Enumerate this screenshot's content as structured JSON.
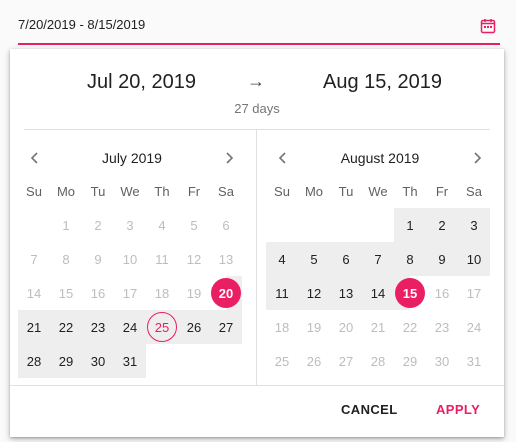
{
  "input": {
    "value": "7/20/2019 - 8/15/2019",
    "icon": "calendar-icon",
    "accent": "#e91e63"
  },
  "range": {
    "start": "Jul 20, 2019",
    "arrow": "→",
    "end": "Aug 15, 2019",
    "days": "27 days"
  },
  "weekdays": [
    "Su",
    "Mo",
    "Tu",
    "We",
    "Th",
    "Fr",
    "Sa"
  ],
  "left": {
    "title": "July 2019",
    "rows": [
      [
        "",
        "1",
        "2",
        "3",
        "4",
        "5",
        "6"
      ],
      [
        "7",
        "8",
        "9",
        "10",
        "11",
        "12",
        "13"
      ],
      [
        "14",
        "15",
        "16",
        "17",
        "18",
        "19",
        "20"
      ],
      [
        "21",
        "22",
        "23",
        "24",
        "25",
        "26",
        "27"
      ],
      [
        "28",
        "29",
        "30",
        "31",
        "",
        "",
        ""
      ]
    ]
  },
  "right": {
    "title": "August 2019",
    "rows": [
      [
        "",
        "",
        "",
        "",
        "1",
        "2",
        "3"
      ],
      [
        "4",
        "5",
        "6",
        "7",
        "8",
        "9",
        "10"
      ],
      [
        "11",
        "12",
        "13",
        "14",
        "15",
        "16",
        "17"
      ],
      [
        "18",
        "19",
        "20",
        "21",
        "22",
        "23",
        "24"
      ],
      [
        "25",
        "26",
        "27",
        "28",
        "29",
        "30",
        "31"
      ]
    ]
  },
  "actions": {
    "cancel": "CANCEL",
    "apply": "APPLY"
  }
}
